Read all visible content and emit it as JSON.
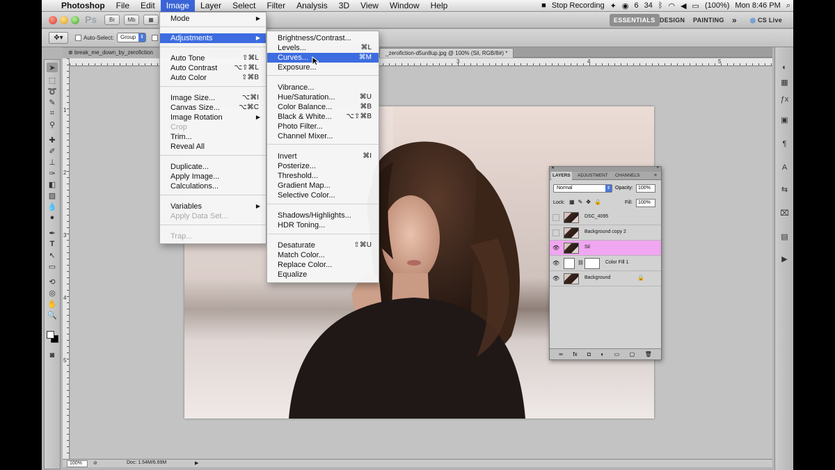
{
  "menubar": {
    "app_name": "Photoshop",
    "items": [
      "File",
      "Edit",
      "Image",
      "Layer",
      "Select",
      "Filter",
      "Analysis",
      "3D",
      "View",
      "Window",
      "Help"
    ],
    "active_item": "Image",
    "stop_recording": "Stop Recording",
    "battery": "(100%)",
    "clock": "Mon 8:46 PM",
    "status_num1": "6",
    "status_num2": "34"
  },
  "appbar": {
    "logo": "Ps",
    "br_label": "Br",
    "mb_label": "Mb",
    "workspaces": [
      "ESSENTIALS",
      "DESIGN",
      "PAINTING"
    ],
    "active_workspace": "ESSENTIALS",
    "more": "»",
    "cs_live": "CS Live"
  },
  "options": {
    "auto_select": "Auto-Select:",
    "group": "Group"
  },
  "tabs": {
    "first": "break_me_down_by_zerofiction",
    "active": "_zerofiction-d5un8up.jpg @ 100% (Sil, RGB/8#) *"
  },
  "image_menu": {
    "items": [
      {
        "label": "Mode",
        "shortcut": "",
        "submenu": true,
        "disabled": false,
        "highlighted": false
      },
      {
        "label": "Adjustments",
        "shortcut": "",
        "submenu": true,
        "disabled": false,
        "highlighted": true
      },
      {
        "label": "Auto Tone",
        "shortcut": "⇧⌘L",
        "submenu": false,
        "disabled": false,
        "highlighted": false
      },
      {
        "label": "Auto Contrast",
        "shortcut": "⌥⇧⌘L",
        "submenu": false,
        "disabled": false,
        "highlighted": false
      },
      {
        "label": "Auto Color",
        "shortcut": "⇧⌘B",
        "submenu": false,
        "disabled": false,
        "highlighted": false
      },
      {
        "label": "Image Size...",
        "shortcut": "⌥⌘I",
        "submenu": false,
        "disabled": false,
        "highlighted": false
      },
      {
        "label": "Canvas Size...",
        "shortcut": "⌥⌘C",
        "submenu": false,
        "disabled": false,
        "highlighted": false
      },
      {
        "label": "Image Rotation",
        "shortcut": "",
        "submenu": true,
        "disabled": false,
        "highlighted": false
      },
      {
        "label": "Crop",
        "shortcut": "",
        "submenu": false,
        "disabled": true,
        "highlighted": false
      },
      {
        "label": "Trim...",
        "shortcut": "",
        "submenu": false,
        "disabled": false,
        "highlighted": false
      },
      {
        "label": "Reveal All",
        "shortcut": "",
        "submenu": false,
        "disabled": false,
        "highlighted": false
      },
      {
        "label": "Duplicate...",
        "shortcut": "",
        "submenu": false,
        "disabled": false,
        "highlighted": false
      },
      {
        "label": "Apply Image...",
        "shortcut": "",
        "submenu": false,
        "disabled": false,
        "highlighted": false
      },
      {
        "label": "Calculations...",
        "shortcut": "",
        "submenu": false,
        "disabled": false,
        "highlighted": false
      },
      {
        "label": "Variables",
        "shortcut": "",
        "submenu": true,
        "disabled": false,
        "highlighted": false
      },
      {
        "label": "Apply Data Set...",
        "shortcut": "",
        "submenu": false,
        "disabled": true,
        "highlighted": false
      },
      {
        "label": "Trap...",
        "shortcut": "",
        "submenu": false,
        "disabled": true,
        "highlighted": false
      }
    ]
  },
  "adjust_menu": {
    "items": [
      {
        "label": "Brightness/Contrast...",
        "shortcut": "",
        "highlighted": false
      },
      {
        "label": "Levels...",
        "shortcut": "⌘L",
        "highlighted": false
      },
      {
        "label": "Curves...",
        "shortcut": "⌘M",
        "highlighted": true
      },
      {
        "label": "Exposure...",
        "shortcut": "",
        "highlighted": false
      },
      {
        "label": "Vibrance...",
        "shortcut": "",
        "highlighted": false
      },
      {
        "label": "Hue/Saturation...",
        "shortcut": "⌘U",
        "highlighted": false
      },
      {
        "label": "Color Balance...",
        "shortcut": "⌘B",
        "highlighted": false
      },
      {
        "label": "Black & White...",
        "shortcut": "⌥⇧⌘B",
        "highlighted": false
      },
      {
        "label": "Photo Filter...",
        "shortcut": "",
        "highlighted": false
      },
      {
        "label": "Channel Mixer...",
        "shortcut": "",
        "highlighted": false
      },
      {
        "label": "Invert",
        "shortcut": "⌘I",
        "highlighted": false
      },
      {
        "label": "Posterize...",
        "shortcut": "",
        "highlighted": false
      },
      {
        "label": "Threshold...",
        "shortcut": "",
        "highlighted": false
      },
      {
        "label": "Gradient Map...",
        "shortcut": "",
        "highlighted": false
      },
      {
        "label": "Selective Color...",
        "shortcut": "",
        "highlighted": false
      },
      {
        "label": "Shadows/Highlights...",
        "shortcut": "",
        "highlighted": false
      },
      {
        "label": "HDR Toning...",
        "shortcut": "",
        "highlighted": false
      },
      {
        "label": "Desaturate",
        "shortcut": "⇧⌘U",
        "highlighted": false
      },
      {
        "label": "Match Color...",
        "shortcut": "",
        "highlighted": false
      },
      {
        "label": "Replace Color...",
        "shortcut": "",
        "highlighted": false
      },
      {
        "label": "Equalize",
        "shortcut": "",
        "highlighted": false
      }
    ]
  },
  "layers_panel": {
    "tabs": [
      "LAYERS",
      "ADJUSTMENT",
      "CHANNELS"
    ],
    "blend_mode": "Normal",
    "opacity_label": "Opacity:",
    "opacity": "100%",
    "lock_label": "Lock:",
    "fill_label": "Fill:",
    "fill": "100%",
    "layers": [
      {
        "name": "DSC_4095",
        "visible": false,
        "selected": false,
        "lock": false
      },
      {
        "name": "Background copy 2",
        "visible": false,
        "selected": false,
        "lock": false
      },
      {
        "name": "Sil",
        "visible": true,
        "selected": true,
        "lock": false
      },
      {
        "name": "Color Fill 1",
        "visible": true,
        "selected": false,
        "lock": false
      },
      {
        "name": "Background",
        "visible": true,
        "selected": false,
        "lock": true
      }
    ],
    "footer_icons": [
      "link-icon",
      "fx-icon",
      "mask-icon",
      "adjustment-icon",
      "group-icon",
      "new-layer-icon",
      "trash-icon"
    ]
  },
  "status": {
    "zoom": "100%",
    "doc": "Doc: 1.54M/6.69M"
  },
  "ruler": {
    "marks": [
      "1",
      "2",
      "3",
      "4",
      "5"
    ],
    "vmarks": [
      "1",
      "2",
      "3",
      "4",
      "5"
    ]
  },
  "colors": {
    "highlight": "#3d6ce0",
    "selected_layer": "#f0a6f0"
  }
}
